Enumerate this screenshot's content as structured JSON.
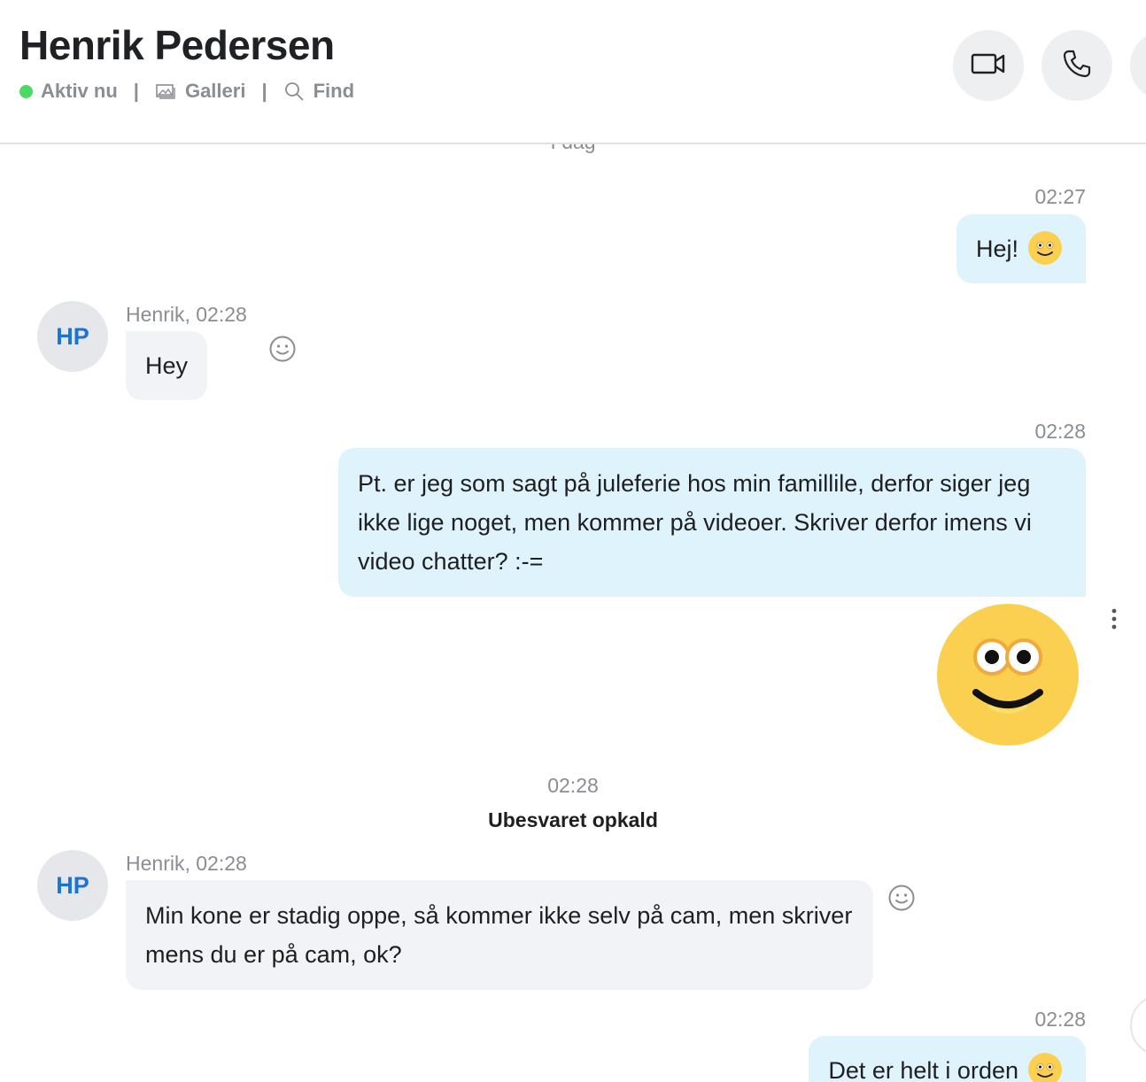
{
  "header": {
    "contact_name": "Henrik Pedersen",
    "status": "Aktiv nu",
    "gallery_label": "Galleri",
    "find_label": "Find",
    "separator": "|",
    "status_color": "#4cd964",
    "icons": [
      "video-call-icon",
      "audio-call-icon",
      "add-participant-icon"
    ]
  },
  "chat": {
    "day_label": "I dag",
    "messages": [
      {
        "direction": "out",
        "time": "02:27",
        "text": "Hej!",
        "emoji": "smile-emoji"
      },
      {
        "direction": "in",
        "avatar": "HP",
        "meta": "Henrik, 02:28",
        "text": "Hey"
      },
      {
        "direction": "out",
        "time": "02:28",
        "text": "Pt. er jeg som sagt på juleferie hos min famillile, derfor siger jeg ikke lige noget, men kommer på videoer. Skriver derfor imens vi video chatter? :-="
      },
      {
        "direction": "out",
        "type": "large-emoji",
        "emoji": "grinning-face-emoji"
      },
      {
        "type": "event",
        "time": "02:28",
        "text": "Ubesvaret opkald"
      },
      {
        "direction": "in",
        "avatar": "HP",
        "meta": "Henrik, 02:28",
        "text": "Min kone er stadig oppe, så kommer ikke selv på cam, men skriver mens du er på cam, ok?"
      },
      {
        "direction": "out",
        "time": "02:28",
        "text": "Det er helt i orden",
        "emoji": "smile-emoji"
      }
    ]
  },
  "colors": {
    "outgoing_bubble": "#dff3fd",
    "incoming_bubble": "#f1f3f6",
    "avatar_text": "#1a75d2",
    "emoji_yellow": "#fbcf4f"
  }
}
